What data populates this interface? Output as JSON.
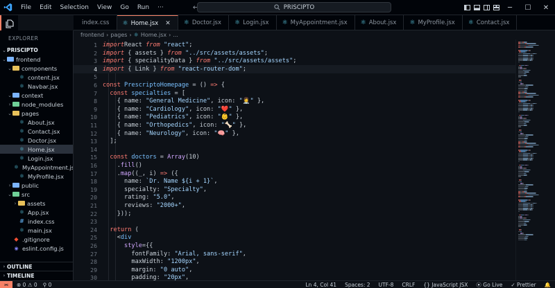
{
  "titlebar": {
    "menu": [
      "File",
      "Edit",
      "Selection",
      "View",
      "Go",
      "Run",
      "···"
    ],
    "search_text": "PRISCIPTO"
  },
  "tabs": [
    {
      "label": "index.css",
      "type": "css"
    },
    {
      "label": "Home.jsx",
      "type": "react",
      "active": true
    },
    {
      "label": "Doctor.jsx",
      "type": "react"
    },
    {
      "label": "Login.jsx",
      "type": "react"
    },
    {
      "label": "MyAppointment.jsx",
      "type": "react"
    },
    {
      "label": "About.jsx",
      "type": "react"
    },
    {
      "label": "MyProfile.jsx",
      "type": "react"
    },
    {
      "label": "Contact.jsx",
      "type": "react"
    }
  ],
  "breadcrumb": [
    "frontend",
    "pages",
    "Home.jsx",
    "..."
  ],
  "explorer": {
    "title": "EXPLORER",
    "project": "PRISCIPTO",
    "tree": [
      {
        "label": "frontend",
        "depth": 1,
        "kind": "folder-blue",
        "open": true
      },
      {
        "label": "components",
        "depth": 2,
        "kind": "folder",
        "open": true
      },
      {
        "label": "content.jsx",
        "depth": 3,
        "kind": "react"
      },
      {
        "label": "Navbar.jsx",
        "depth": 3,
        "kind": "react"
      },
      {
        "label": "context",
        "depth": 2,
        "kind": "folder-blue",
        "open": true
      },
      {
        "label": "node_modules",
        "depth": 2,
        "kind": "folder-green",
        "open": false
      },
      {
        "label": "pages",
        "depth": 2,
        "kind": "folder",
        "open": true
      },
      {
        "label": "About.jsx",
        "depth": 3,
        "kind": "react"
      },
      {
        "label": "Contact.jsx",
        "depth": 3,
        "kind": "react"
      },
      {
        "label": "Doctor.jsx",
        "depth": 3,
        "kind": "react"
      },
      {
        "label": "Home.jsx",
        "depth": 3,
        "kind": "react",
        "selected": true
      },
      {
        "label": "Login.jsx",
        "depth": 3,
        "kind": "react"
      },
      {
        "label": "MyAppointment.jsx",
        "depth": 3,
        "kind": "react"
      },
      {
        "label": "MyProfile.jsx",
        "depth": 3,
        "kind": "react"
      },
      {
        "label": "public",
        "depth": 2,
        "kind": "folder-blue",
        "open": false
      },
      {
        "label": "src",
        "depth": 2,
        "kind": "folder-green",
        "open": true
      },
      {
        "label": "assets",
        "depth": 3,
        "kind": "folder",
        "open": false
      },
      {
        "label": "App.jsx",
        "depth": 3,
        "kind": "react"
      },
      {
        "label": "index.css",
        "depth": 3,
        "kind": "css"
      },
      {
        "label": "main.jsx",
        "depth": 3,
        "kind": "react"
      },
      {
        "label": ".gitignore",
        "depth": 2,
        "kind": "git"
      },
      {
        "label": "eslint.config.js",
        "depth": 2,
        "kind": "js"
      }
    ],
    "outline": "OUTLINE",
    "timeline": "TIMELINE"
  },
  "editor": {
    "current_line": 4,
    "lines": [
      [
        [
          "kw2",
          "import"
        ],
        [
          "",
          "React "
        ],
        [
          "kw2",
          "from"
        ],
        [
          "str",
          " \"react\""
        ],
        [
          "",
          ";"
        ]
      ],
      [
        [
          "kw2",
          "import"
        ],
        [
          "",
          " { assets } "
        ],
        [
          "kw2",
          "from"
        ],
        [
          "str",
          " \"../src/assets/assets\""
        ],
        [
          "",
          ";"
        ]
      ],
      [
        [
          "kw2",
          "import"
        ],
        [
          "",
          " { specialityData } "
        ],
        [
          "kw2",
          "from"
        ],
        [
          "str",
          " \"../src/assets/assets\""
        ],
        [
          "",
          ";"
        ]
      ],
      [
        [
          "kw2",
          "import"
        ],
        [
          "",
          " { Link } "
        ],
        [
          "kw2",
          "from"
        ],
        [
          "str",
          " \"react-router-dom\""
        ],
        [
          "",
          ";"
        ]
      ],
      [],
      [
        [
          "kw",
          "const "
        ],
        [
          "var",
          "PrescriptoHomepage"
        ],
        [
          "",
          " = () "
        ],
        [
          "kw",
          "=>"
        ],
        [
          "",
          " {"
        ]
      ],
      [
        [
          "",
          "  "
        ],
        [
          "kw",
          "const "
        ],
        [
          "var",
          "specialties"
        ],
        [
          "",
          " = ["
        ]
      ],
      [
        [
          "",
          "    { name: "
        ],
        [
          "str",
          "\"General Medicine\""
        ],
        [
          "",
          ", icon: "
        ],
        [
          "str",
          "\"👩‍⚕️\""
        ],
        [
          "",
          " },"
        ]
      ],
      [
        [
          "",
          "    { name: "
        ],
        [
          "str",
          "\"Cardiology\""
        ],
        [
          "",
          ", icon: "
        ],
        [
          "str",
          "\"❤️\""
        ],
        [
          "",
          " },"
        ]
      ],
      [
        [
          "",
          "    { name: "
        ],
        [
          "str",
          "\"Pediatrics\""
        ],
        [
          "",
          ", icon: "
        ],
        [
          "str",
          "\"👶\""
        ],
        [
          "",
          " },"
        ]
      ],
      [
        [
          "",
          "    { name: "
        ],
        [
          "str",
          "\"Orthopedics\""
        ],
        [
          "",
          ", icon: "
        ],
        [
          "str",
          "\"🦴\""
        ],
        [
          "",
          " },"
        ]
      ],
      [
        [
          "",
          "    { name: "
        ],
        [
          "str",
          "\"Neurology\""
        ],
        [
          "",
          ", icon: "
        ],
        [
          "str",
          "\"🧠\""
        ],
        [
          "",
          " },"
        ]
      ],
      [
        [
          "",
          "  ];"
        ]
      ],
      [],
      [
        [
          "",
          "  "
        ],
        [
          "kw",
          "const "
        ],
        [
          "var",
          "doctors"
        ],
        [
          "",
          " = "
        ],
        [
          "fn",
          "Array"
        ],
        [
          "",
          "(10)"
        ]
      ],
      [
        [
          "",
          "    ."
        ],
        [
          "fn",
          "fill"
        ],
        [
          "",
          "()"
        ]
      ],
      [
        [
          "",
          "    ."
        ],
        [
          "fn",
          "map"
        ],
        [
          "",
          "((_, i) "
        ],
        [
          "kw",
          "=>"
        ],
        [
          "",
          " ({"
        ]
      ],
      [
        [
          "",
          "      name: "
        ],
        [
          "str",
          "`Dr. Name ${i + 1}`"
        ],
        [
          "",
          ","
        ]
      ],
      [
        [
          "",
          "      specialty: "
        ],
        [
          "str",
          "\"Specialty\""
        ],
        [
          "",
          ","
        ]
      ],
      [
        [
          "",
          "      rating: "
        ],
        [
          "str",
          "\"5.0\""
        ],
        [
          "",
          ","
        ]
      ],
      [
        [
          "",
          "      reviews: "
        ],
        [
          "str",
          "\"2000+\""
        ],
        [
          "",
          ","
        ]
      ],
      [
        [
          "",
          "    }));"
        ]
      ],
      [],
      [
        [
          "",
          "  "
        ],
        [
          "kw",
          "return"
        ],
        [
          "",
          " ("
        ]
      ],
      [
        [
          "",
          "    <"
        ],
        [
          "var",
          "div"
        ]
      ],
      [
        [
          "",
          "      "
        ],
        [
          "fn",
          "style"
        ],
        [
          "",
          "={{"
        ]
      ],
      [
        [
          "",
          "        fontFamily: "
        ],
        [
          "str",
          "\"Arial, sans-serif\""
        ],
        [
          "",
          ","
        ]
      ],
      [
        [
          "",
          "        maxWidth: "
        ],
        [
          "str",
          "\"1200px\""
        ],
        [
          "",
          ","
        ]
      ],
      [
        [
          "",
          "        margin: "
        ],
        [
          "str",
          "\"0 auto\""
        ],
        [
          "",
          ","
        ]
      ],
      [
        [
          "",
          "        padding: "
        ],
        [
          "str",
          "\"20px\""
        ],
        [
          "",
          ","
        ]
      ]
    ]
  },
  "status": {
    "left": [
      "⊗ 0 ⚠ 0",
      "⚲ 0"
    ],
    "position": "Ln 4, Col 41",
    "spaces": "Spaces: 2",
    "encoding": "UTF-8",
    "eol": "CRLF",
    "language": "{} JavaScript JSX",
    "golive": "Go Live",
    "prettier": "✓ Prettier"
  }
}
